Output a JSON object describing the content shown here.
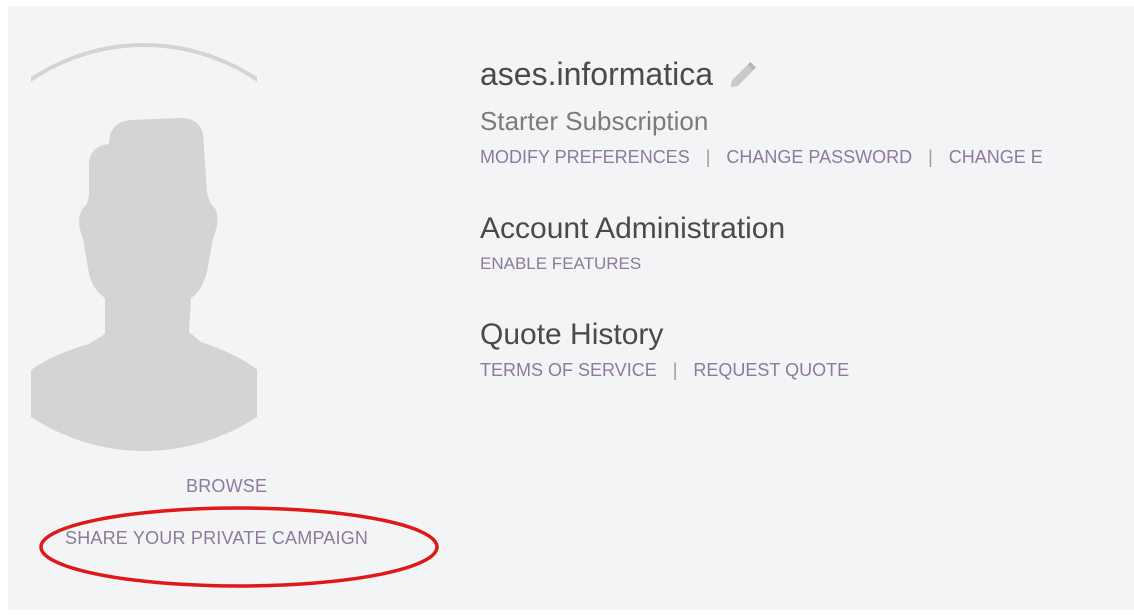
{
  "profile": {
    "username": "ases.informatica",
    "subscription": "Starter Subscription",
    "links": {
      "modify_preferences": "MODIFY PREFERENCES",
      "change_password": "CHANGE PASSWORD",
      "change_truncated": "CHANGE E",
      "separator": "|"
    }
  },
  "account_admin": {
    "title": "Account Administration",
    "enable_features": "ENABLE FEATURES"
  },
  "quote_history": {
    "title": "Quote History",
    "terms_of_service": "TERMS OF SERVICE",
    "request_quote": "REQUEST QUOTE",
    "separator": "|"
  },
  "avatar": {
    "browse_label": "BROWSE",
    "share_label": "SHARE YOUR PRIVATE CAMPAIGN",
    "icon": "user-silhouette-icon"
  },
  "annotation": {
    "highlight_color": "#e01818"
  },
  "colors": {
    "link": "#8e7a9c",
    "heading": "#4a4a4a",
    "panel_bg": "#f2f4f6",
    "avatar_fill": "#d2d4d6"
  }
}
